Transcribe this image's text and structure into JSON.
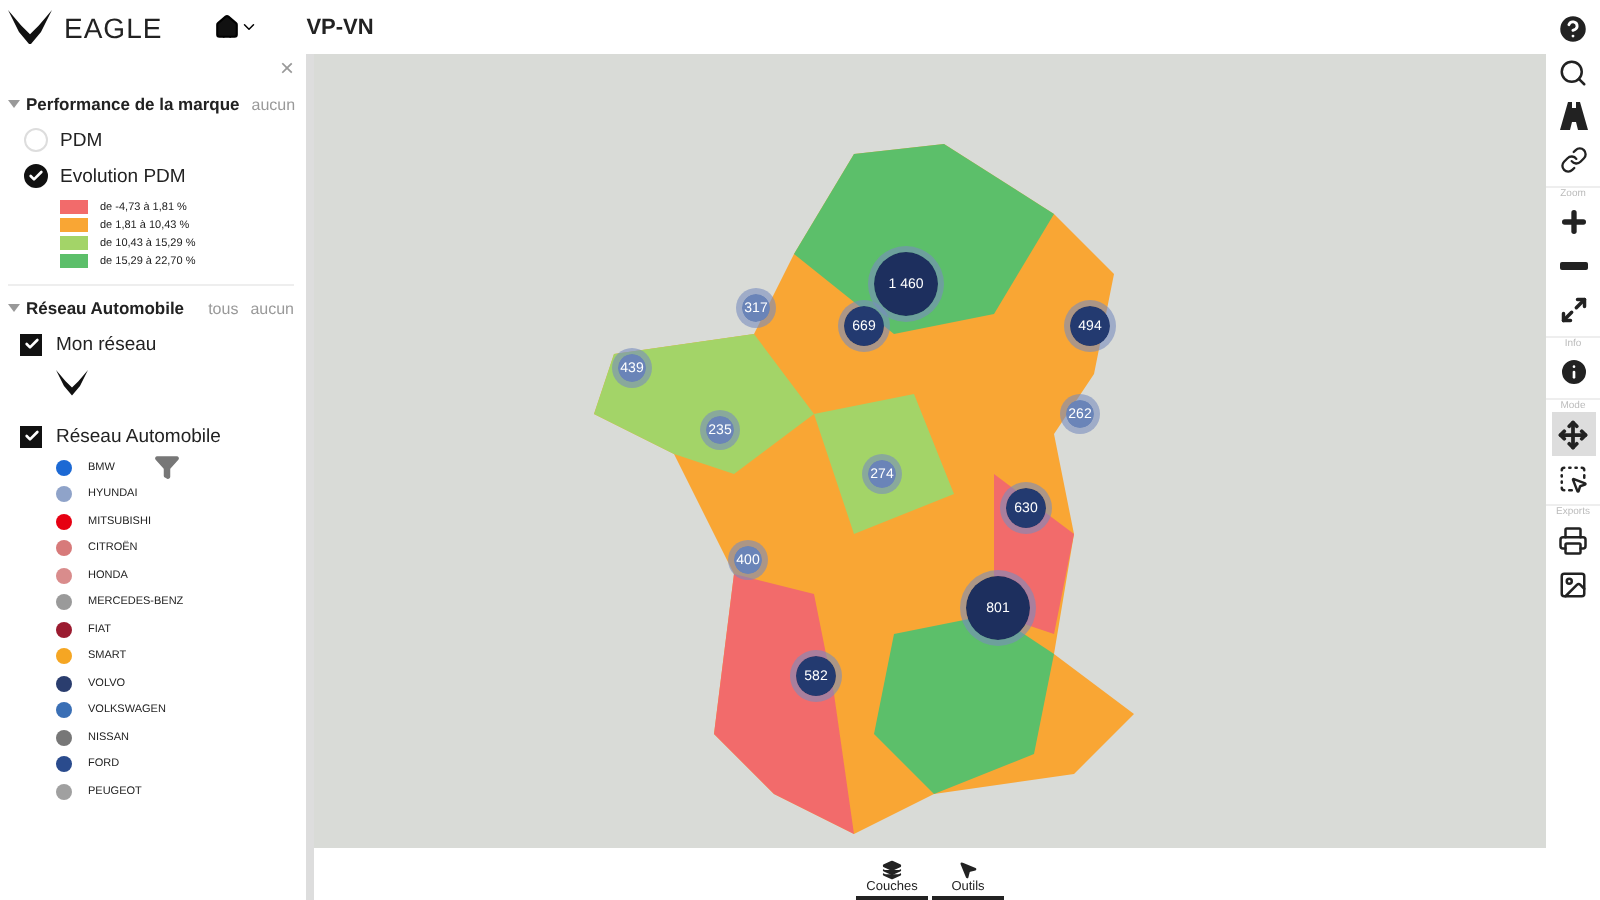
{
  "header": {
    "brand": "EAGLE",
    "nav": "VP-VN"
  },
  "sidebar": {
    "close": "×",
    "sections": [
      {
        "title": "Performance de la marque",
        "expanded": true,
        "actions": [
          "aucun"
        ],
        "options": [
          {
            "label": "PDM",
            "selected": false
          },
          {
            "label": "Evolution PDM",
            "selected": true
          }
        ],
        "legend": [
          {
            "label": "de -4,73 à 1,81 %",
            "color": "#f26b6b"
          },
          {
            "label": "de 1,81 à 10,43 %",
            "color": "#f9a634"
          },
          {
            "label": "de 10,43 à 15,29 %",
            "color": "#a3d468"
          },
          {
            "label": "de 15,29 à 22,70 %",
            "color": "#5cbf6a"
          }
        ]
      },
      {
        "title": "Réseau Automobile",
        "expanded": true,
        "actions": [
          "tous",
          "aucun"
        ],
        "layers": [
          {
            "label": "Mon réseau",
            "checked": true
          },
          {
            "label": "Réseau Automobile",
            "checked": true
          }
        ],
        "brands": [
          {
            "label": "BMW",
            "color": "#1c69d4"
          },
          {
            "label": "HYUNDAI",
            "color": "#8fa3c9"
          },
          {
            "label": "MITSUBISHI",
            "color": "#e60012"
          },
          {
            "label": "CITROËN",
            "color": "#d77a7a"
          },
          {
            "label": "HONDA",
            "color": "#d98c8c"
          },
          {
            "label": "MERCEDES-BENZ",
            "color": "#9a9a9a"
          },
          {
            "label": "FIAT",
            "color": "#9b1b30"
          },
          {
            "label": "SMART",
            "color": "#f5a623"
          },
          {
            "label": "VOLVO",
            "color": "#2a3d6e"
          },
          {
            "label": "VOLKSWAGEN",
            "color": "#3a6fb5"
          },
          {
            "label": "NISSAN",
            "color": "#777777"
          },
          {
            "label": "FORD",
            "color": "#2a4b8d"
          },
          {
            "label": "PEUGEOT",
            "color": "#a0a0a0"
          }
        ]
      }
    ]
  },
  "map": {
    "clusters": [
      {
        "count": "1 460"
      },
      {
        "count": "669"
      },
      {
        "count": "494"
      },
      {
        "count": "439"
      },
      {
        "count": "317"
      },
      {
        "count": "235"
      },
      {
        "count": "262"
      },
      {
        "count": "274"
      },
      {
        "count": "630"
      },
      {
        "count": "400"
      },
      {
        "count": "801"
      },
      {
        "count": "582"
      }
    ]
  },
  "toolbar": [
    {
      "items": [
        {
          "kind": "help",
          "selected": false
        },
        {
          "kind": "search",
          "selected": false
        },
        {
          "kind": "road",
          "selected": false
        },
        {
          "kind": "link",
          "selected": false
        }
      ]
    },
    {
      "label": "Zoom",
      "items": [
        {
          "kind": "plus",
          "selected": false
        },
        {
          "kind": "minus",
          "selected": false
        },
        {
          "kind": "expand",
          "selected": false
        }
      ]
    },
    {
      "label": "Info",
      "items": [
        {
          "kind": "info",
          "selected": false
        }
      ]
    },
    {
      "label": "Mode",
      "items": [
        {
          "kind": "move",
          "selected": true
        },
        {
          "kind": "select",
          "selected": false
        }
      ]
    },
    {
      "label": "Exports",
      "items": [
        {
          "kind": "print",
          "selected": false
        },
        {
          "kind": "image",
          "selected": false
        }
      ]
    }
  ],
  "bottom_tabs": [
    {
      "label": "Couches",
      "kind": "layers"
    },
    {
      "label": "Outils",
      "kind": "pointer"
    }
  ]
}
